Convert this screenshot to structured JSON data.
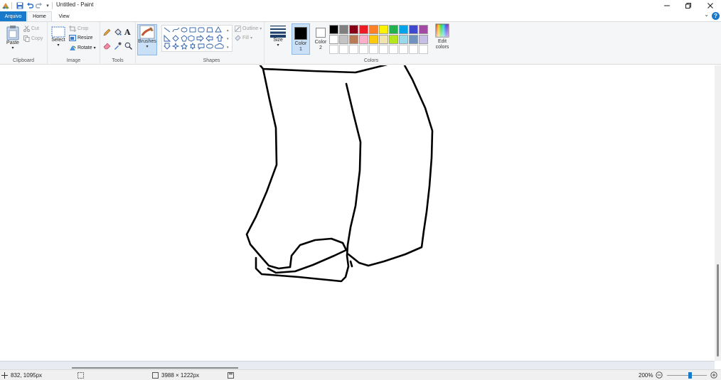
{
  "title": "Untitled - Paint",
  "quick_access_more": "▾",
  "tabs": {
    "file": "Arquivo",
    "home": "Home",
    "view": "View"
  },
  "ribbon": {
    "clipboard": {
      "label": "Clipboard",
      "paste": "Paste",
      "cut": "Cut",
      "copy": "Copy"
    },
    "image": {
      "label": "Image",
      "select": "Select",
      "crop": "Crop",
      "resize": "Resize",
      "rotate": "Rotate"
    },
    "tools": {
      "label": "Tools"
    },
    "brushes": {
      "label": "Brushes"
    },
    "shapes": {
      "label": "Shapes",
      "outline": "Outline",
      "fill": "Fill"
    },
    "size": {
      "label": "Size"
    },
    "colors": {
      "label": "Colors",
      "color1_label": "Color 1",
      "color1_label_l1": "Color",
      "color1_label_l2": "1",
      "color2_label_l1": "Color",
      "color2_label_l2": "2",
      "edit_label_l1": "Edit",
      "edit_label_l2": "colors",
      "color1": "#000000",
      "color2": "#ffffff",
      "palette_row1": [
        "#000000",
        "#7f7f7f",
        "#880015",
        "#ed1c24",
        "#ff7f27",
        "#fff200",
        "#22b14c",
        "#00a2e8",
        "#3f48cc",
        "#a349a4"
      ],
      "palette_row2": [
        "#ffffff",
        "#c3c3c3",
        "#b97a57",
        "#ffaec9",
        "#ffc90e",
        "#efe4b0",
        "#b5e61d",
        "#99d9ea",
        "#7092be",
        "#c8bfe7"
      ],
      "palette_row3": [
        "#ffffff",
        "#ffffff",
        "#ffffff",
        "#ffffff",
        "#ffffff",
        "#ffffff",
        "#ffffff",
        "#ffffff",
        "#ffffff",
        "#ffffff"
      ]
    }
  },
  "status": {
    "cursor_pos": "832, 1095px",
    "canvas_size": "3988 × 1222px",
    "zoom": "200%"
  }
}
